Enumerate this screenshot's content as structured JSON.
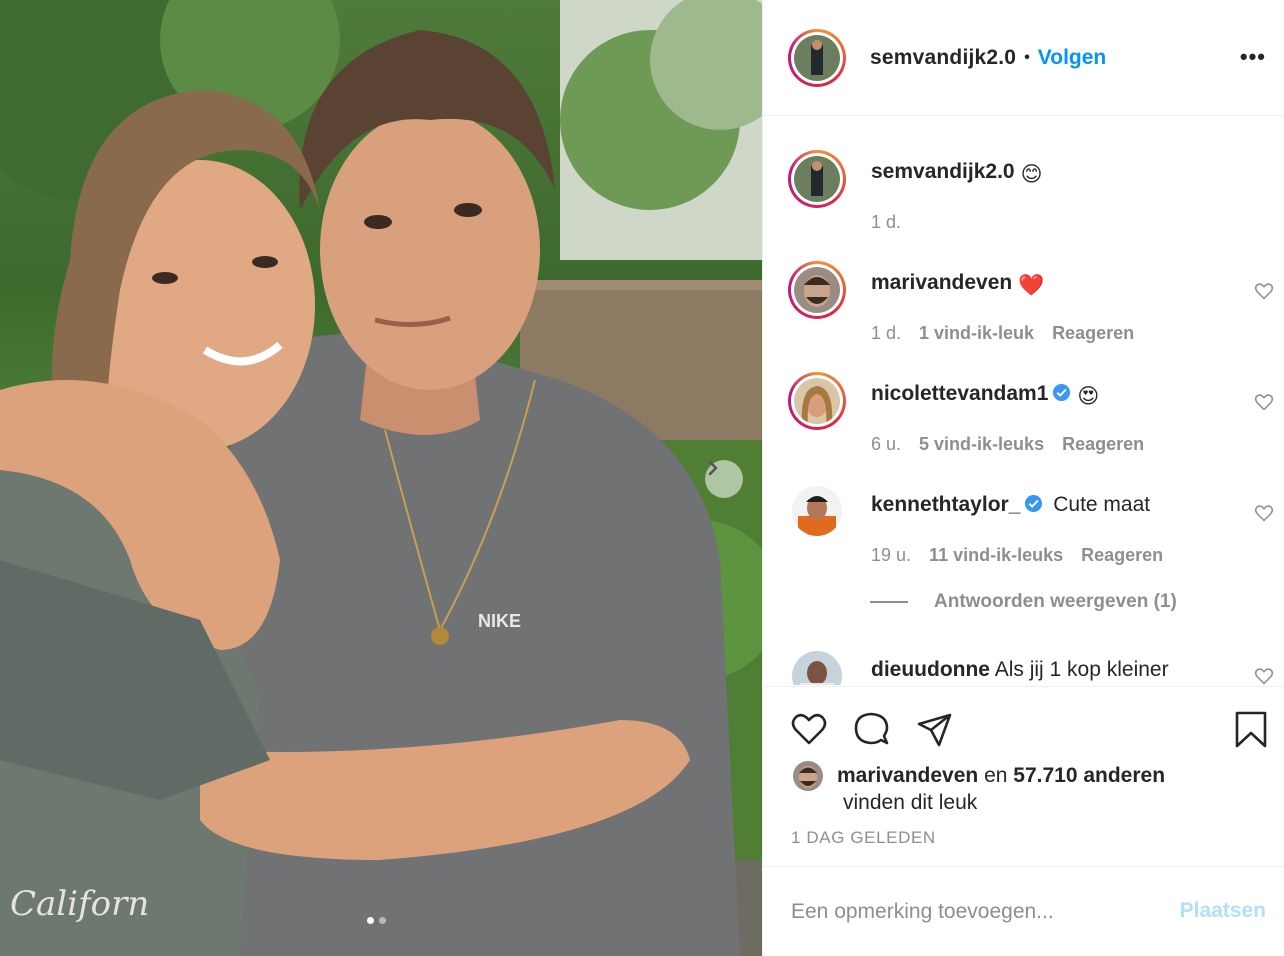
{
  "post": {
    "author": "semvandijk2.0",
    "separator": "•",
    "follow_label": "Volgen",
    "more_label": "•••",
    "carousel": {
      "slides": 2,
      "active": 1
    }
  },
  "caption": {
    "user": "semvandijk2.0",
    "emoji": "😊",
    "time": "1 d."
  },
  "comments": [
    {
      "user": "marivandeven",
      "text": "",
      "emoji": "❤️",
      "verified": false,
      "time": "1 d.",
      "likes": "1 vind-ik-leuk",
      "reply": "Reageren"
    },
    {
      "user": "nicolettevandam1",
      "text": "",
      "emoji": "😍",
      "verified": true,
      "time": "6 u.",
      "likes": "5 vind-ik-leuks",
      "reply": "Reageren"
    },
    {
      "user": "kennethtaylor_",
      "text": "Cute maat",
      "emoji": "",
      "verified": true,
      "time": "19 u.",
      "likes": "11 vind-ik-leuks",
      "reply": "Reageren"
    },
    {
      "user": "dieuudonne",
      "text": "Als jij 1 kop kleiner",
      "emoji": "",
      "verified": false
    }
  ],
  "replies_toggle": "Antwoorden weergeven (1)",
  "likes": {
    "first_user": "marivandeven",
    "connector": " en ",
    "others": "57.710 anderen",
    "suffix": "vinden dit leuk"
  },
  "timestamp": "1 DAG GELEDEN",
  "comment_box": {
    "placeholder": "Een opmerking toevoegen...",
    "post_label": "Plaatsen"
  },
  "colors": {
    "link_blue": "#0095f6",
    "muted": "#8e8e8e",
    "post_disabled": "#b2dffc",
    "verified_blue": "#3897f0",
    "heart_red": "#ed4956"
  },
  "icons": [
    "heart-icon",
    "comment-icon",
    "share-icon",
    "bookmark-icon",
    "verified-icon",
    "chevron-right-icon",
    "more-icon"
  ]
}
